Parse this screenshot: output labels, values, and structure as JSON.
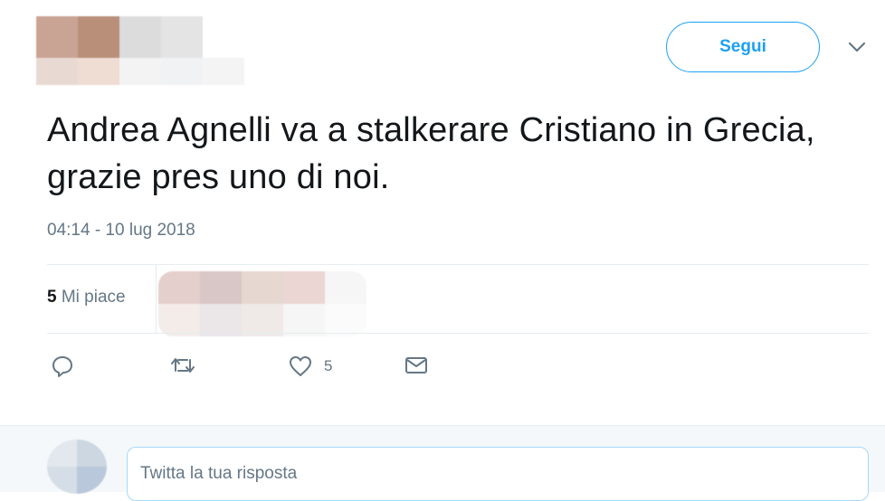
{
  "tweet": {
    "follow_label": "Segui",
    "text": "Andrea Agnelli va a stalkerare Cristiano in Grecia, grazie pres uno di noi.",
    "timestamp": "04:14 - 10 lug 2018",
    "likes": {
      "count": "5",
      "label": "Mi piace"
    },
    "actions": {
      "like_count": "5"
    }
  },
  "reply": {
    "placeholder": "Twitta la tua risposta"
  },
  "colors": {
    "accent": "#1da1f2",
    "secondary_text": "#657786",
    "divider": "#e6ecf0"
  }
}
